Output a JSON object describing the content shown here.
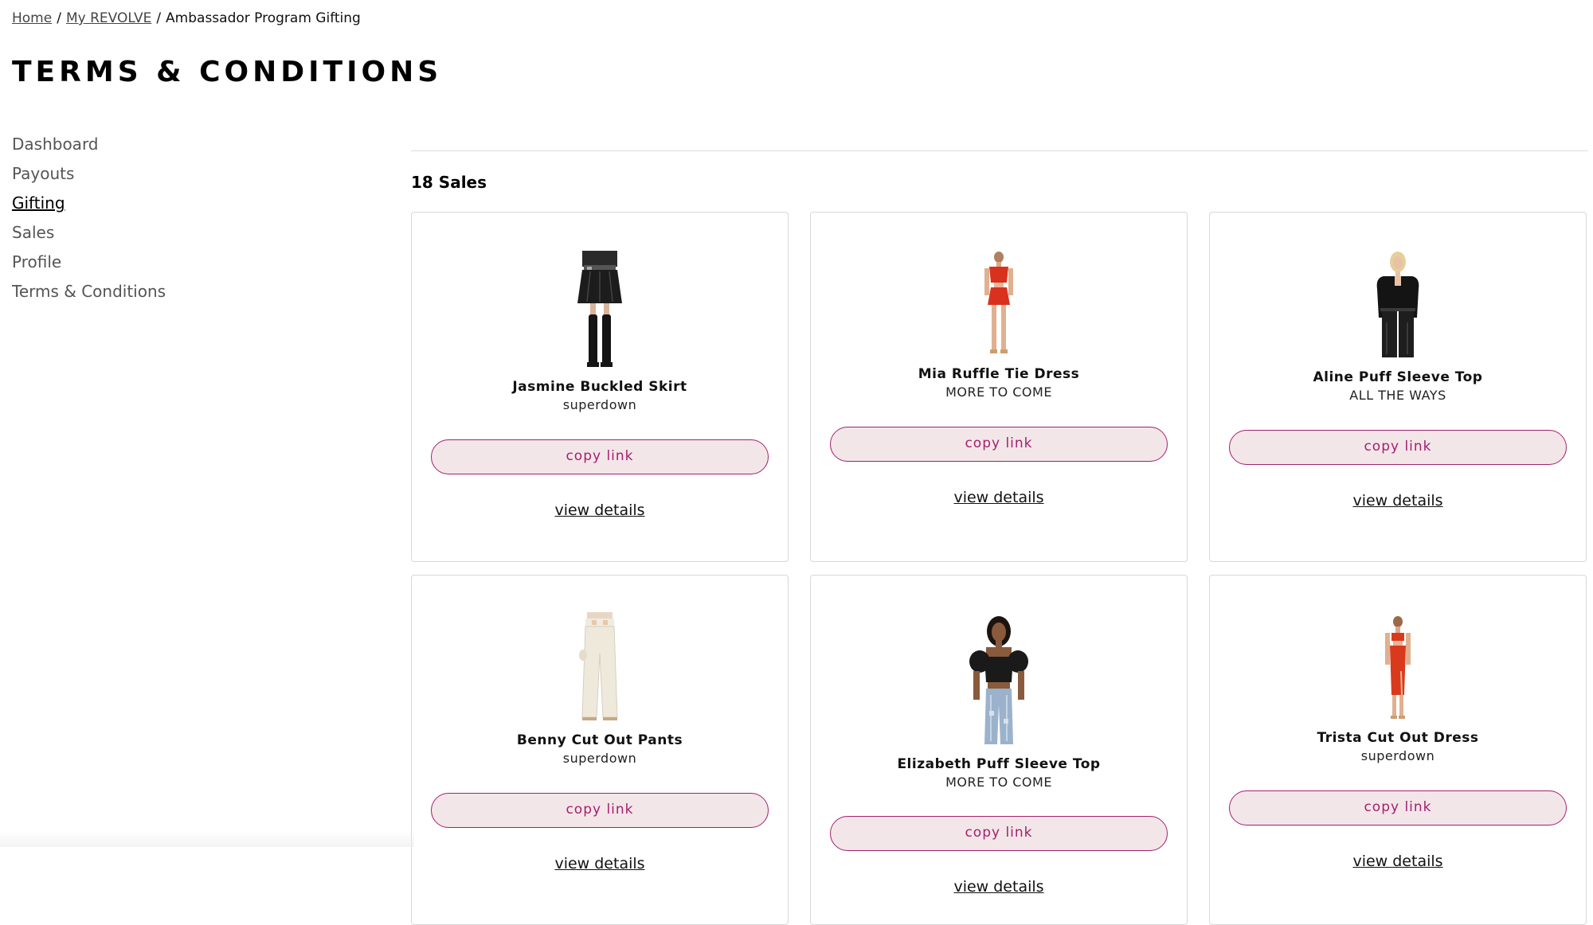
{
  "breadcrumb": {
    "home": "Home",
    "my_revolve": "My REVOLVE",
    "current": "Ambassador Program Gifting",
    "separator": "/"
  },
  "page_title": "TERMS & CONDITIONS",
  "sidebar": {
    "items": [
      {
        "label": "Dashboard"
      },
      {
        "label": "Payouts"
      },
      {
        "label": "Gifting",
        "active": true
      },
      {
        "label": "Sales"
      },
      {
        "label": "Profile"
      },
      {
        "label": "Terms & Conditions"
      }
    ]
  },
  "sales_count": "18 Sales",
  "colors": {
    "accent": "#a3206e",
    "button_bg": "#f3e6e8",
    "card_border": "#d8d8d8"
  },
  "products": [
    {
      "name": "Jasmine Buckled Skirt",
      "brand": "superdown",
      "copy_label": "copy link",
      "details_label": "view details"
    },
    {
      "name": "Mia Ruffle Tie Dress",
      "brand": "MORE TO COME",
      "copy_label": "copy link",
      "details_label": "view details"
    },
    {
      "name": "Aline Puff Sleeve Top",
      "brand": "ALL THE WAYS",
      "copy_label": "copy link",
      "details_label": "view details"
    },
    {
      "name": "Benny Cut Out Pants",
      "brand": "superdown",
      "copy_label": "copy link",
      "details_label": "view details"
    },
    {
      "name": "Elizabeth Puff Sleeve Top",
      "brand": "MORE TO COME",
      "copy_label": "copy link",
      "details_label": "view details"
    },
    {
      "name": "Trista Cut Out Dress",
      "brand": "superdown",
      "copy_label": "copy link",
      "details_label": "view details"
    }
  ]
}
